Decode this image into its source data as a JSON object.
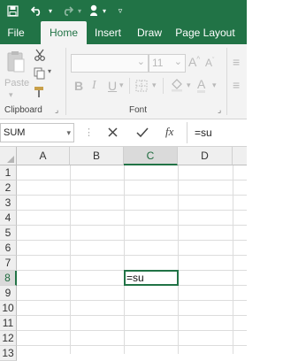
{
  "quick_access": {
    "icons": [
      "save-icon",
      "undo-icon",
      "redo-icon",
      "touch-mode-icon",
      "customize-icon"
    ]
  },
  "tabs": [
    "File",
    "Home",
    "Insert",
    "Draw",
    "Page Layout"
  ],
  "active_tab": "Home",
  "ribbon": {
    "paste_label": "Paste",
    "clipboard_label": "Clipboard",
    "font_label": "Font",
    "font_size": "11",
    "bold": "B",
    "italic": "I",
    "underline": "U",
    "grow_font": "A",
    "shrink_font": "A",
    "font_color": "A"
  },
  "name_box": "SUM",
  "formula": {
    "fx": "fx",
    "value": "=su"
  },
  "columns": [
    "A",
    "B",
    "C",
    "D"
  ],
  "rows": [
    "1",
    "2",
    "3",
    "4",
    "5",
    "6",
    "7",
    "8",
    "9",
    "10",
    "11",
    "12",
    "13"
  ],
  "active_cell": {
    "ref": "C8",
    "value": "=su"
  },
  "colors": {
    "brand": "#217346",
    "ribbon": "#f3f3f3"
  }
}
